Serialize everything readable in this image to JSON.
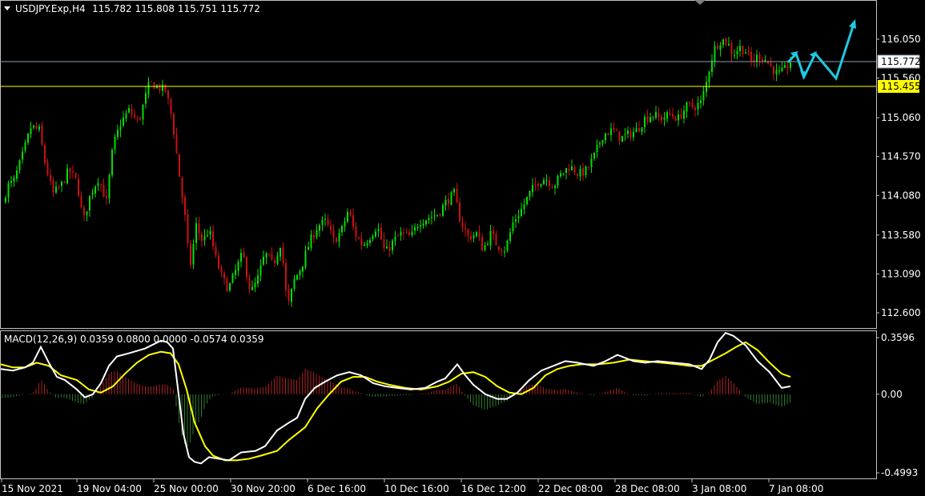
{
  "header": {
    "symbol": "USDJPY.Exp,H4",
    "ohlc": "115.782 115.808 115.751 115.772"
  },
  "macd_header": "MACD(12,26,9) 0.0359 0.0800 0.0000 -0.0574 0.0359",
  "colors": {
    "background": "#000000",
    "bull": "#00e000",
    "bear": "#cc1111",
    "price_line": "#8c9cb4",
    "level_line": "#ffff00",
    "macd_main": "#ffffff",
    "macd_signal": "#ffff00",
    "histogram_pos": "#aa2020",
    "histogram_neg": "#2c7a2c",
    "forecast": "#1ec8e0",
    "frame": "#c0c0c0"
  },
  "icons": {
    "menu": "triangle-down-icon",
    "shift": "chart-shift-icon"
  },
  "chart_data": [
    {
      "type": "candlestick",
      "title": "USDJPY.Exp,H4",
      "y_ticks": [
        "116.050",
        "115.560",
        "115.060",
        "114.570",
        "114.080",
        "113.580",
        "113.090",
        "112.600"
      ],
      "x_ticks": [
        "15 Nov 2021",
        "19 Nov 04:00",
        "25 Nov 00:00",
        "30 Nov 20:00",
        "6 Dec 16:00",
        "10 Dec 16:00",
        "16 Dec 12:00",
        "22 Dec 08:00",
        "28 Dec 08:00",
        "3 Jan 08:00",
        "7 Jan 08:00"
      ],
      "current_price": "115.772",
      "level_price": "115.455",
      "path": [
        [
          0,
          113.85
        ],
        [
          8,
          114.2
        ],
        [
          16,
          114.25
        ],
        [
          26,
          114.55
        ],
        [
          38,
          114.95
        ],
        [
          48,
          114.9
        ],
        [
          55,
          114.5
        ],
        [
          65,
          114.1
        ],
        [
          75,
          114.2
        ],
        [
          85,
          114.4
        ],
        [
          95,
          114.25
        ],
        [
          103,
          113.75
        ],
        [
          112,
          114.1
        ],
        [
          122,
          114.3
        ],
        [
          132,
          114.0
        ],
        [
          140,
          114.7
        ],
        [
          150,
          115.0
        ],
        [
          160,
          115.15
        ],
        [
          172,
          115.0
        ],
        [
          180,
          115.3
        ],
        [
          186,
          115.5
        ],
        [
          196,
          115.45
        ],
        [
          206,
          115.4
        ],
        [
          214,
          115.05
        ],
        [
          222,
          114.4
        ],
        [
          230,
          113.8
        ],
        [
          236,
          113.15
        ],
        [
          244,
          113.7
        ],
        [
          252,
          113.5
        ],
        [
          260,
          113.65
        ],
        [
          268,
          113.3
        ],
        [
          276,
          113.05
        ],
        [
          284,
          112.9
        ],
        [
          292,
          113.1
        ],
        [
          302,
          113.35
        ],
        [
          312,
          112.85
        ],
        [
          320,
          113.0
        ],
        [
          330,
          113.35
        ],
        [
          340,
          113.2
        ],
        [
          350,
          113.5
        ],
        [
          358,
          112.65
        ],
        [
          366,
          113.0
        ],
        [
          376,
          113.2
        ],
        [
          386,
          113.5
        ],
        [
          396,
          113.7
        ],
        [
          406,
          113.75
        ],
        [
          416,
          113.5
        ],
        [
          426,
          113.65
        ],
        [
          434,
          113.9
        ],
        [
          442,
          113.6
        ],
        [
          452,
          113.45
        ],
        [
          460,
          113.55
        ],
        [
          470,
          113.7
        ],
        [
          480,
          113.35
        ],
        [
          490,
          113.5
        ],
        [
          500,
          113.6
        ],
        [
          512,
          113.55
        ],
        [
          522,
          113.75
        ],
        [
          534,
          113.8
        ],
        [
          546,
          113.85
        ],
        [
          556,
          114.0
        ],
        [
          566,
          114.1
        ],
        [
          574,
          113.75
        ],
        [
          584,
          113.55
        ],
        [
          594,
          113.6
        ],
        [
          602,
          113.4
        ],
        [
          612,
          113.6
        ],
        [
          620,
          113.45
        ],
        [
          630,
          113.4
        ],
        [
          640,
          113.75
        ],
        [
          650,
          113.9
        ],
        [
          660,
          114.1
        ],
        [
          670,
          114.25
        ],
        [
          680,
          114.3
        ],
        [
          690,
          114.2
        ],
        [
          700,
          114.35
        ],
        [
          710,
          114.45
        ],
        [
          722,
          114.35
        ],
        [
          732,
          114.4
        ],
        [
          742,
          114.6
        ],
        [
          752,
          114.85
        ],
        [
          764,
          114.9
        ],
        [
          774,
          114.8
        ],
        [
          784,
          114.85
        ],
        [
          794,
          114.9
        ],
        [
          804,
          115.05
        ],
        [
          814,
          115.1
        ],
        [
          824,
          115.05
        ],
        [
          836,
          115.1
        ],
        [
          846,
          115.05
        ],
        [
          856,
          115.2
        ],
        [
          866,
          115.2
        ],
        [
          874,
          115.25
        ],
        [
          880,
          115.45
        ],
        [
          886,
          115.75
        ],
        [
          892,
          115.95
        ],
        [
          900,
          116.05
        ],
        [
          908,
          116.0
        ],
        [
          914,
          115.85
        ],
        [
          922,
          115.95
        ],
        [
          930,
          115.9
        ],
        [
          938,
          115.75
        ],
        [
          946,
          115.85
        ],
        [
          954,
          115.8
        ],
        [
          962,
          115.7
        ],
        [
          970,
          115.6
        ],
        [
          978,
          115.65
        ],
        [
          986,
          115.772
        ]
      ]
    },
    {
      "type": "macd",
      "title": "MACD(12,26,9)",
      "y_ticks": [
        "0.3596",
        "0.00",
        "-0.4993"
      ],
      "ylim": [
        -0.4993,
        0.3596
      ],
      "main": [
        [
          0,
          0.16
        ],
        [
          15,
          0.15
        ],
        [
          30,
          0.17
        ],
        [
          40,
          0.2
        ],
        [
          50,
          0.3
        ],
        [
          60,
          0.2
        ],
        [
          70,
          0.11
        ],
        [
          80,
          0.09
        ],
        [
          95,
          0.03
        ],
        [
          105,
          -0.02
        ],
        [
          115,
          0.0
        ],
        [
          125,
          0.07
        ],
        [
          135,
          0.18
        ],
        [
          145,
          0.24
        ],
        [
          160,
          0.26
        ],
        [
          180,
          0.29
        ],
        [
          200,
          0.34
        ],
        [
          208,
          0.33
        ],
        [
          215,
          0.29
        ],
        [
          222,
          0.0
        ],
        [
          228,
          -0.25
        ],
        [
          235,
          -0.4
        ],
        [
          242,
          -0.43
        ],
        [
          250,
          -0.44
        ],
        [
          260,
          -0.4
        ],
        [
          272,
          -0.41
        ],
        [
          285,
          -0.42
        ],
        [
          300,
          -0.37
        ],
        [
          318,
          -0.36
        ],
        [
          330,
          -0.33
        ],
        [
          345,
          -0.23
        ],
        [
          360,
          -0.18
        ],
        [
          370,
          -0.15
        ],
        [
          380,
          -0.03
        ],
        [
          392,
          0.04
        ],
        [
          405,
          0.08
        ],
        [
          420,
          0.12
        ],
        [
          435,
          0.14
        ],
        [
          450,
          0.12
        ],
        [
          465,
          0.07
        ],
        [
          480,
          0.05
        ],
        [
          495,
          0.04
        ],
        [
          512,
          0.03
        ],
        [
          530,
          0.04
        ],
        [
          545,
          0.08
        ],
        [
          555,
          0.1
        ],
        [
          570,
          0.19
        ],
        [
          580,
          0.12
        ],
        [
          590,
          0.06
        ],
        [
          605,
          0.0
        ],
        [
          620,
          -0.03
        ],
        [
          632,
          -0.03
        ],
        [
          645,
          0.01
        ],
        [
          660,
          0.09
        ],
        [
          675,
          0.15
        ],
        [
          690,
          0.18
        ],
        [
          705,
          0.21
        ],
        [
          720,
          0.2
        ],
        [
          740,
          0.18
        ],
        [
          755,
          0.21
        ],
        [
          770,
          0.25
        ],
        [
          790,
          0.21
        ],
        [
          805,
          0.2
        ],
        [
          820,
          0.21
        ],
        [
          840,
          0.2
        ],
        [
          860,
          0.19
        ],
        [
          875,
          0.16
        ],
        [
          885,
          0.22
        ],
        [
          895,
          0.33
        ],
        [
          905,
          0.39
        ],
        [
          915,
          0.37
        ],
        [
          930,
          0.31
        ],
        [
          945,
          0.21
        ],
        [
          960,
          0.14
        ],
        [
          975,
          0.04
        ],
        [
          986,
          0.05
        ]
      ],
      "signal": [
        [
          0,
          0.19
        ],
        [
          15,
          0.17
        ],
        [
          30,
          0.17
        ],
        [
          45,
          0.2
        ],
        [
          60,
          0.18
        ],
        [
          75,
          0.12
        ],
        [
          95,
          0.09
        ],
        [
          110,
          0.03
        ],
        [
          125,
          0.01
        ],
        [
          140,
          0.05
        ],
        [
          155,
          0.13
        ],
        [
          170,
          0.2
        ],
        [
          185,
          0.25
        ],
        [
          200,
          0.27
        ],
        [
          212,
          0.26
        ],
        [
          222,
          0.19
        ],
        [
          232,
          0.03
        ],
        [
          242,
          -0.18
        ],
        [
          255,
          -0.33
        ],
        [
          265,
          -0.39
        ],
        [
          280,
          -0.42
        ],
        [
          295,
          -0.42
        ],
        [
          310,
          -0.41
        ],
        [
          325,
          -0.39
        ],
        [
          345,
          -0.36
        ],
        [
          360,
          -0.29
        ],
        [
          380,
          -0.21
        ],
        [
          395,
          -0.09
        ],
        [
          410,
          0.0
        ],
        [
          425,
          0.08
        ],
        [
          440,
          0.11
        ],
        [
          455,
          0.11
        ],
        [
          470,
          0.08
        ],
        [
          485,
          0.06
        ],
        [
          505,
          0.04
        ],
        [
          525,
          0.03
        ],
        [
          545,
          0.05
        ],
        [
          560,
          0.08
        ],
        [
          575,
          0.13
        ],
        [
          590,
          0.14
        ],
        [
          605,
          0.11
        ],
        [
          620,
          0.05
        ],
        [
          635,
          0.01
        ],
        [
          650,
          0.0
        ],
        [
          665,
          0.04
        ],
        [
          680,
          0.12
        ],
        [
          695,
          0.16
        ],
        [
          710,
          0.18
        ],
        [
          725,
          0.19
        ],
        [
          745,
          0.19
        ],
        [
          765,
          0.2
        ],
        [
          785,
          0.22
        ],
        [
          805,
          0.21
        ],
        [
          825,
          0.2
        ],
        [
          845,
          0.19
        ],
        [
          860,
          0.18
        ],
        [
          875,
          0.18
        ],
        [
          890,
          0.22
        ],
        [
          905,
          0.26
        ],
        [
          918,
          0.3
        ],
        [
          930,
          0.33
        ],
        [
          945,
          0.28
        ],
        [
          960,
          0.2
        ],
        [
          975,
          0.13
        ],
        [
          986,
          0.11
        ]
      ]
    }
  ]
}
